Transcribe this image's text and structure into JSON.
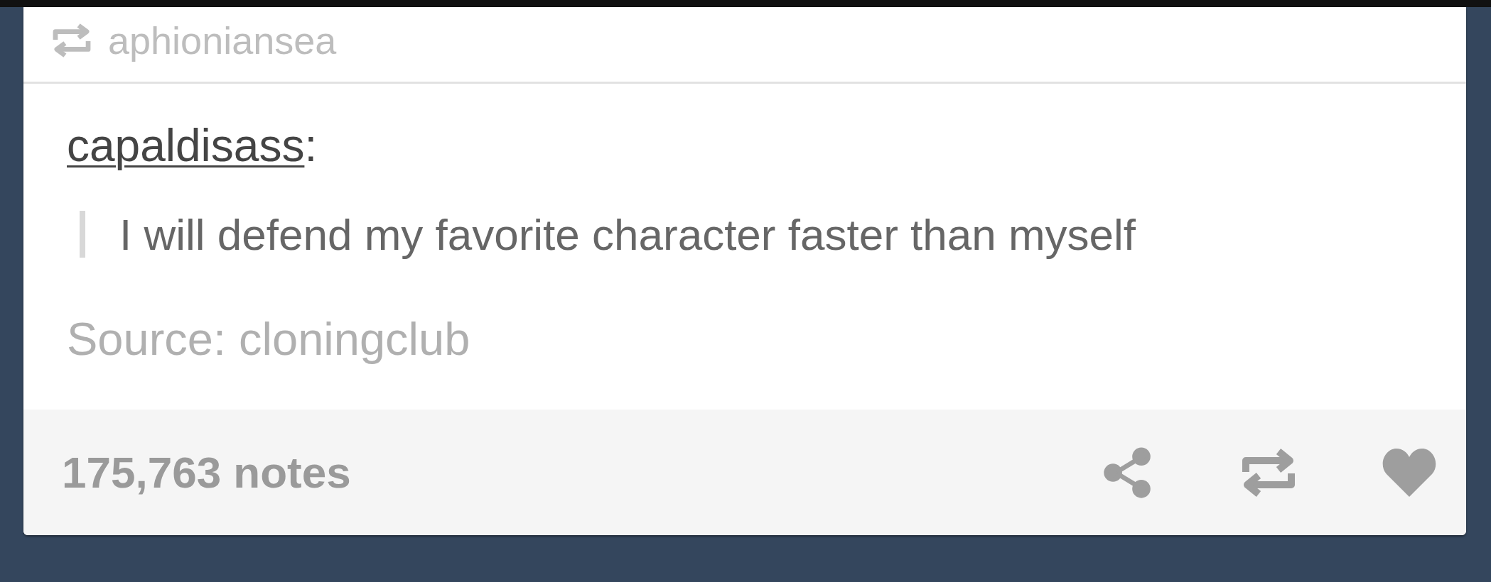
{
  "reblogger": {
    "name": "aphioniansea"
  },
  "post": {
    "author": "capaldisass",
    "separator": ":",
    "quote": "I will defend my favorite character faster than myself",
    "source": "Source: cloningclub"
  },
  "footer": {
    "notes": "175,763 notes"
  }
}
